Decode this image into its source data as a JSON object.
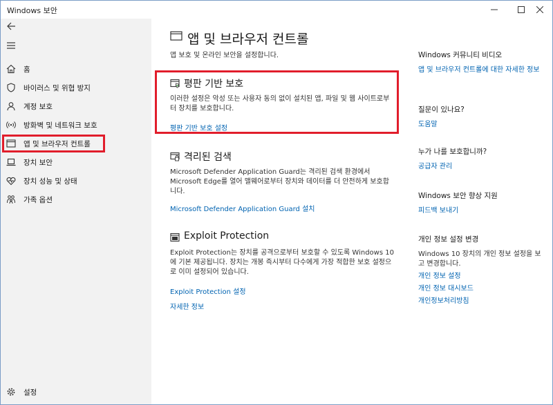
{
  "window": {
    "title": "Windows 보안"
  },
  "sidebar": {
    "items": [
      {
        "label": "홈",
        "icon": "home-icon"
      },
      {
        "label": "바이러스 및 위협 방지",
        "icon": "shield-icon"
      },
      {
        "label": "계정 보호",
        "icon": "person-icon"
      },
      {
        "label": "방화벽 및 네트워크 보호",
        "icon": "wifi-antenna-icon"
      },
      {
        "label": "앱 및 브라우저 컨트롤",
        "icon": "app-window-icon"
      },
      {
        "label": "장치 보안",
        "icon": "laptop-icon"
      },
      {
        "label": "장치 성능 및 상태",
        "icon": "heart-icon"
      },
      {
        "label": "가족 옵션",
        "icon": "family-icon"
      }
    ],
    "selected_index": 4,
    "settings_label": "설정"
  },
  "main": {
    "title": "앱 및 브라우저 컨트롤",
    "subtitle": "앱 보호 및 온라인 보안을 설정합니다.",
    "sections": [
      {
        "title": "평판 기반 보호",
        "description": "이러한 설정은 악성 또는 사용자 동의 없이 설치된 앱, 파일 및 웹 사이트로부터 장치를 보호합니다.",
        "links": [
          "평판 기반 보호 설정"
        ]
      },
      {
        "title": "격리된 검색",
        "description": "Microsoft Defender Application Guard는 격리된 검색 환경에서 Microsoft Edge를 열어 맬웨어로부터 장치와 데이터를 더 안전하게 보호합니다.",
        "links": [
          "Microsoft Defender Application Guard 설치"
        ]
      },
      {
        "title": "Exploit Protection",
        "description": "Exploit Protection는 장치를 공격으로부터 보호할 수 있도록 Windows 10에 기본 제공됩니다. 장치는 개봉 즉시부터 다수에게 가장 적합한 보호 설정으로 이미 설정되어 있습니다.",
        "links": [
          "Exploit Protection 설정",
          "자세한 정보"
        ]
      }
    ]
  },
  "right": {
    "community": {
      "heading": "Windows 커뮤니티 비디오",
      "link": "앱 및 브라우저 컨트롤에 대한 자세한 정보"
    },
    "question": {
      "heading": "질문이 있나요?",
      "link": "도움말"
    },
    "protector": {
      "heading": "누가 나를 보호합니까?",
      "link": "공급자 관리"
    },
    "improve": {
      "heading": "Windows 보안 향상 지원",
      "link": "피드백 보내기"
    },
    "privacy": {
      "heading": "개인 정보 설정 변경",
      "text": "Windows 10 장치의 개인 정보 설정을 보고 변경합니다.",
      "links": [
        "개인 정보 설정",
        "개인 정보 대시보드",
        "개인정보처리방침"
      ]
    }
  }
}
